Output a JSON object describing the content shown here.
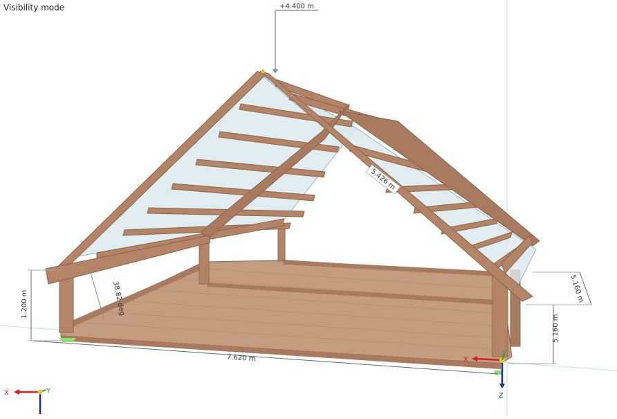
{
  "viewport": {
    "mode_label": "Visibility mode"
  },
  "dimensions": {
    "ridge_height": "+4.400 m",
    "rafter_length": "5.426 m",
    "roof_angle": "38.82 deg",
    "knee_wall_height": "1.200 m",
    "width": "7.620 m",
    "depth_right": "5.160 m",
    "depth_front": "5.160 m"
  },
  "axes": {
    "corner": {
      "x": "X",
      "y": "Y"
    },
    "model": {
      "x": "X",
      "y": "Y",
      "z": "Z"
    }
  },
  "colors": {
    "timber": "#b48466",
    "timber_dark": "#8c634b",
    "floor": "#c49c80",
    "roof_panel": "#dbe8ee",
    "axis_x": "#d8201f",
    "axis_y": "#1ea51e",
    "axis_z": "#1c2a8c",
    "support": "#88e070"
  }
}
